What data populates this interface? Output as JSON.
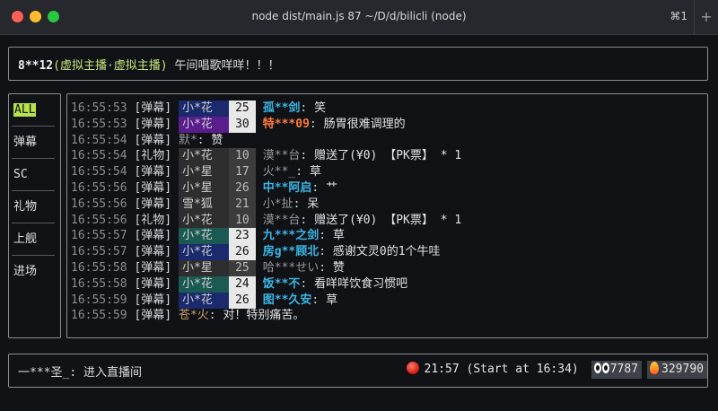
{
  "window": {
    "title": "node dist/main.js 87 ~/D/d/bilicli (node)",
    "shortcut": "⌘1",
    "new_tab": "+"
  },
  "top": {
    "name": "8**12",
    "medal": "(虚拟主播·虚拟主播)",
    "message": "午间唱歌咩咩！！！"
  },
  "sidebar": {
    "items": [
      {
        "label": "ALL",
        "active": true
      },
      {
        "label": "弹幕"
      },
      {
        "label": "SC"
      },
      {
        "label": "礼物"
      },
      {
        "label": "上舰"
      },
      {
        "label": "进场"
      }
    ]
  },
  "messages": [
    {
      "time": "16:55:53",
      "tag": "[弹幕]",
      "medal": "小*花",
      "level": "25",
      "medal_bg": "#1a2a6c",
      "level_bg": "#e8e8e8",
      "level_color": "#111111",
      "user": "孤**剑",
      "user_color": "#3ab7e6",
      "content": "笑"
    },
    {
      "time": "16:55:53",
      "tag": "[弹幕]",
      "medal": "小*花",
      "level": "30",
      "medal_bg": "#5a1d8e",
      "level_bg": "#e8e8e8",
      "level_color": "#111111",
      "user": "特***09",
      "user_color": "#ff7b3a",
      "content": "肠胃很难调理的"
    },
    {
      "time": "16:55:54",
      "tag": "[弹幕]",
      "medal": "",
      "level": "",
      "user": "默*",
      "user_color": "#9a9a9a",
      "content": "赞"
    },
    {
      "time": "16:55:54",
      "tag": "[礼物]",
      "medal": "小*花",
      "level": "10",
      "medal_bg": "#2e2e2e",
      "level_bg": "#3c3c3c",
      "level_color": "#bbbbbb",
      "user": "漠**台",
      "user_color": "#9a9a9a",
      "content": "赠送了(¥0) 【PK票】 * 1"
    },
    {
      "time": "16:55:54",
      "tag": "[弹幕]",
      "medal": "小*星",
      "level": "17",
      "medal_bg": "#2e2e2e",
      "level_bg": "#3c3c3c",
      "level_color": "#bbbbbb",
      "user": "火**_",
      "user_color": "#9a9a9a",
      "content": "草"
    },
    {
      "time": "16:55:56",
      "tag": "[弹幕]",
      "medal": "小*星",
      "level": "26",
      "medal_bg": "#2e2e2e",
      "level_bg": "#3c3c3c",
      "level_color": "#bbbbbb",
      "user": "中**阿启",
      "user_color": "#3ab7e6",
      "content": "艹"
    },
    {
      "time": "16:55:56",
      "tag": "[弹幕]",
      "medal": "雪*狐",
      "level": "21",
      "medal_bg": "#2e2e2e",
      "level_bg": "#3c3c3c",
      "level_color": "#bbbbbb",
      "user": "小*扯",
      "user_color": "#9a9a9a",
      "content": "呆"
    },
    {
      "time": "16:55:56",
      "tag": "[礼物]",
      "medal": "小*花",
      "level": "10",
      "medal_bg": "#2e2e2e",
      "level_bg": "#3c3c3c",
      "level_color": "#bbbbbb",
      "user": "漠**台",
      "user_color": "#9a9a9a",
      "content": "赠送了(¥0) 【PK票】 * 1"
    },
    {
      "time": "16:55:57",
      "tag": "[弹幕]",
      "medal": "小*花",
      "level": "23",
      "medal_bg": "#1b5a52",
      "level_bg": "#e8e8e8",
      "level_color": "#111111",
      "user": "九***之剑",
      "user_color": "#3ab7e6",
      "content": "草"
    },
    {
      "time": "16:55:57",
      "tag": "[弹幕]",
      "medal": "小*花",
      "level": "26",
      "medal_bg": "#1a2a6c",
      "level_bg": "#e8e8e8",
      "level_color": "#111111",
      "user": "房g**顾北",
      "user_color": "#3ab7e6",
      "content": "感谢文灵0的1个牛哇"
    },
    {
      "time": "16:55:58",
      "tag": "[弹幕]",
      "medal": "小*星",
      "level": "25",
      "medal_bg": "#2e2e2e",
      "level_bg": "#3c3c3c",
      "level_color": "#bbbbbb",
      "user": "哈***せい",
      "user_color": "#9a9a9a",
      "content": "赞"
    },
    {
      "time": "16:55:58",
      "tag": "[弹幕]",
      "medal": "小*花",
      "level": "24",
      "medal_bg": "#1b5a52",
      "level_bg": "#e8e8e8",
      "level_color": "#111111",
      "user": "饭**不",
      "user_color": "#3ab7e6",
      "content": "看咩咩饮食习惯吧"
    },
    {
      "time": "16:55:59",
      "tag": "[弹幕]",
      "medal": "小*花",
      "level": "26",
      "medal_bg": "#1a2a6c",
      "level_bg": "#e8e8e8",
      "level_color": "#111111",
      "user": "图**久安",
      "user_color": "#3ab7e6",
      "content": "草"
    },
    {
      "time": "16:55:59",
      "tag": "[弹幕]",
      "medal": "",
      "level": "",
      "user": "苍*火",
      "user_color": "#c8a26a",
      "content": "对！特别痛苦。"
    }
  ],
  "bottom": {
    "entry_user": "一***圣_",
    "entry_text": "进入直播间",
    "status": "21:57 (Start at 16:34)",
    "viewers": "7787",
    "popularity": "329790"
  }
}
